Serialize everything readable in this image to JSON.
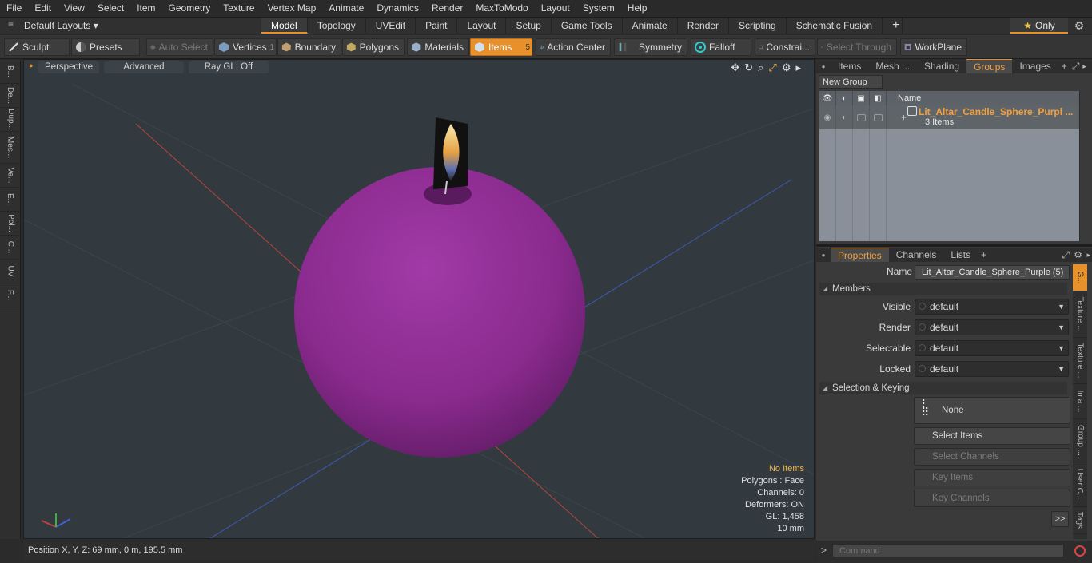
{
  "menubar": {
    "items": [
      "File",
      "Edit",
      "View",
      "Select",
      "Item",
      "Geometry",
      "Texture",
      "Vertex Map",
      "Animate",
      "Dynamics",
      "Render",
      "MaxToModo",
      "Layout",
      "System",
      "Help"
    ]
  },
  "layoutbar": {
    "layout_dropdown": "Default Layouts",
    "tabs": [
      "Model",
      "Topology",
      "UVEdit",
      "Paint",
      "Layout",
      "Setup",
      "Game Tools",
      "Animate",
      "Render",
      "Scripting",
      "Schematic Fusion"
    ],
    "active_tab": "Model",
    "only_label": "Only"
  },
  "toolbar": {
    "sculpt": "Sculpt",
    "presets": "Presets",
    "auto_select": "Auto Select",
    "vertices": "Vertices",
    "vertices_count": "1",
    "boundary": "Boundary",
    "polygons": "Polygons",
    "materials": "Materials",
    "items": "Items",
    "items_count": "5",
    "action_center": "Action Center",
    "symmetry": "Symmetry",
    "falloff": "Falloff",
    "constraints": "Constrai...",
    "select_through": "Select Through",
    "workplane": "WorkPlane"
  },
  "left_tabs": [
    "B...",
    "De...",
    "Dup...",
    "Mes...",
    "Ve...",
    "E...",
    "Pol...",
    "C...",
    "UV",
    "F..."
  ],
  "viewport": {
    "perspective": "Perspective",
    "advanced": "Advanced",
    "raygl": "Ray GL: Off",
    "info": {
      "no_items": "No Items",
      "polygons": "Polygons : Face",
      "channels": "Channels: 0",
      "deformers": "Deformers: ON",
      "gl": "GL: 1,458",
      "scale": "10 mm"
    }
  },
  "statusbar": {
    "position": "Position X, Y, Z:  69 mm, 0 m, 195.5 mm"
  },
  "groups_panel": {
    "tabs": [
      "Items",
      "Mesh ...",
      "Shading",
      "Groups",
      "Images"
    ],
    "active_tab": "Groups",
    "new_group": "New Group",
    "name_header": "Name",
    "group_name": "Lit_Altar_Candle_Sphere_Purpl ...",
    "group_count": "3 Items"
  },
  "properties_panel": {
    "tabs": [
      "Properties",
      "Channels",
      "Lists"
    ],
    "active_tab": "Properties",
    "name_label": "Name",
    "name_value": "Lit_Altar_Candle_Sphere_Purple (5)",
    "members_section": "Members",
    "visible_label": "Visible",
    "visible_value": "default",
    "render_label": "Render",
    "render_value": "default",
    "selectable_label": "Selectable",
    "selectable_value": "default",
    "locked_label": "Locked",
    "locked_value": "default",
    "selection_section": "Selection & Keying",
    "none_button": "None",
    "select_items": "Select Items",
    "select_channels": "Select Channels",
    "key_items": "Key Items",
    "key_channels": "Key Channels",
    "more": ">>"
  },
  "right_tabs": [
    "G...",
    "Texture ...",
    "Texture ...",
    "Ima ...",
    "Group ...",
    "User C...",
    "Tags"
  ],
  "command": {
    "placeholder": "Command",
    "prompt": ">"
  },
  "colors": {
    "accent": "#e8902a",
    "sphere": "#8a2a8e",
    "viewport_bg": "#323a40"
  }
}
